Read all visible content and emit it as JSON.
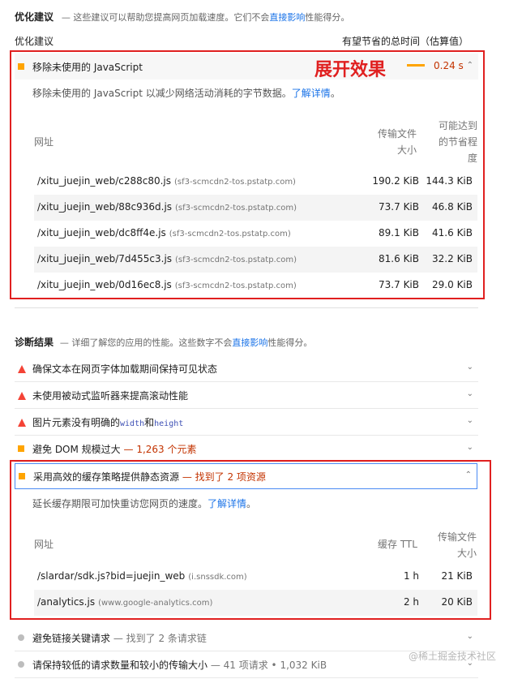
{
  "opportunities": {
    "title": "优化建议",
    "desc_pre": "— 这些建议可以帮助您提高网页加载速度。它们不会",
    "desc_link": "直接影响",
    "desc_post": "性能得分。",
    "col_left": "优化建议",
    "col_right": "有望节省的总时间（估算值）"
  },
  "audit_unused_js": {
    "title": "移除未使用的 JavaScript",
    "savings": "0.24 s",
    "overlay_label": "展开效果",
    "description": "移除未使用的 JavaScript 以减少网络活动消耗的字节数据。",
    "learn_more": "了解详情",
    "table": {
      "headers": [
        "网址",
        "传输文件\n大小",
        "可能达到\n的节省程度"
      ],
      "header_url": "网址",
      "header_size_1": "传输文件",
      "header_size_2": "大小",
      "header_savings_1": "可能达到",
      "header_savings_2": "的节省程",
      "header_savings_3": "度",
      "rows": [
        {
          "url": "/xitu_juejin_web/c288c80.js",
          "host": "(sf3-scmcdn2-tos.pstatp.com)",
          "size": "190.2 KiB",
          "savings": "144.3 KiB"
        },
        {
          "url": "/xitu_juejin_web/88c936d.js",
          "host": "(sf3-scmcdn2-tos.pstatp.com)",
          "size": "73.7 KiB",
          "savings": "46.8 KiB"
        },
        {
          "url": "/xitu_juejin_web/dc8ff4e.js",
          "host": "(sf3-scmcdn2-tos.pstatp.com)",
          "size": "89.1 KiB",
          "savings": "41.6 KiB"
        },
        {
          "url": "/xitu_juejin_web/7d455c3.js",
          "host": "(sf3-scmcdn2-tos.pstatp.com)",
          "size": "81.6 KiB",
          "savings": "32.2 KiB"
        },
        {
          "url": "/xitu_juejin_web/0d16ec8.js",
          "host": "(sf3-scmcdn2-tos.pstatp.com)",
          "size": "73.7 KiB",
          "savings": "29.0 KiB"
        }
      ]
    }
  },
  "diagnostics": {
    "title": "诊断结果",
    "desc_pre": "— 详细了解您的应用的性能。这些数字不会",
    "desc_link": "直接影响",
    "desc_post": "性能得分。"
  },
  "audits": [
    {
      "title": "确保文本在网页字体加载期间保持可见状态"
    },
    {
      "title": "未使用被动式监听器来提高滚动性能"
    },
    {
      "title_pre": "图片元素没有明确的",
      "code1": "width",
      "mid": "和",
      "code2": "height"
    },
    {
      "title": "避免 DOM 规模过大",
      "extra": "— 1,263 个元素"
    }
  ],
  "audit_cache": {
    "title": "采用高效的缓存策略提供静态资源",
    "extra": "— 找到了 2 项资源",
    "description": "延长缓存期限可加快重访您网页的速度。",
    "learn_more": "了解详情",
    "header_url": "网址",
    "header_ttl": "缓存 TTL",
    "header_size_1": "传输文件",
    "header_size_2": "大小",
    "rows": [
      {
        "url": "/slardar/sdk.js?bid=juejin_web",
        "host": "(i.snssdk.com)",
        "ttl": "1 h",
        "size": "21 KiB"
      },
      {
        "url": "/analytics.js",
        "host": "(www.google-analytics.com)",
        "ttl": "2 h",
        "size": "20 KiB"
      }
    ]
  },
  "passed": [
    {
      "title": "避免链接关键请求",
      "extra": "— 找到了 2 条请求链"
    },
    {
      "title": "请保持较低的请求数量和较小的传输大小",
      "extra": "— 41 项请求 • 1,032 KiB"
    }
  ],
  "watermark": "@稀土掘金技术社区",
  "colors": {
    "warn": "#ffa400",
    "fail": "#f44336",
    "accent_red": "#e02020",
    "link": "#1a73e8"
  }
}
